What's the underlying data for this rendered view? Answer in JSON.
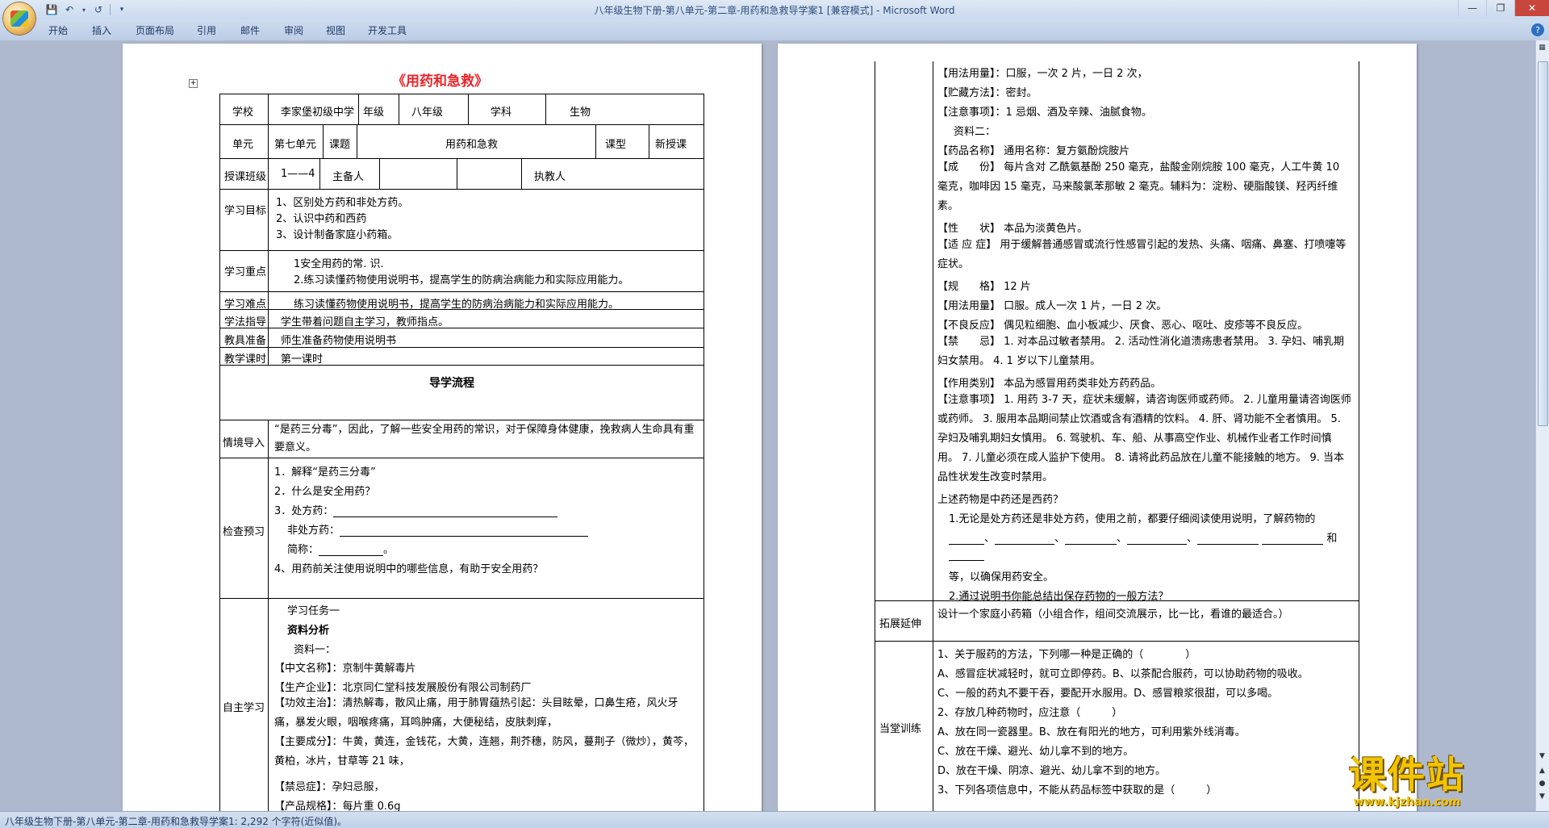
{
  "window": {
    "title": "八年级生物下册-第八单元-第二章-用药和急救导学案1 [兼容模式] - Microsoft Word"
  },
  "ribbon": {
    "tabs": [
      "开始",
      "插入",
      "页面布局",
      "引用",
      "邮件",
      "审阅",
      "视图",
      "开发工具"
    ]
  },
  "statusbar": {
    "text": "八年级生物下册-第八单元-第二章-用药和急救导学案1: 2,292 个字符(近似值)。"
  },
  "watermark": {
    "text": "课件站",
    "url": "www.kjzhan.com",
    "color": "#f2c400"
  },
  "page1": {
    "title": "《用药和急救》",
    "header_rows": {
      "school_label": "学校",
      "school_value": "李家堡初级中学",
      "grade_label": "年级",
      "grade_value": "八年级",
      "subject_label": "学科",
      "subject_value": "生物",
      "unit_label": "单元",
      "unit_value": "第七单元",
      "topic_label": "课题",
      "topic_value": "用药和急救",
      "type_label": "课型",
      "type_value": "新授课",
      "class_label": "授课班级",
      "class_value": "1——4",
      "prep_label": "主备人",
      "teacher_label": "执教人"
    },
    "goals_label": "学习目标",
    "goals": [
      "1、区别处方药和非处方药。",
      "2、认识中药和西药",
      "3、设计制备家庭小药箱。"
    ],
    "focus_label": "学习重点",
    "focus": [
      "1安全用药的常. 识.",
      "2.练习读懂药物使用说明书，提高学生的防病治病能力和实际应用能力。"
    ],
    "difficulty_label": "学习难点",
    "difficulty": "练习读懂药物使用说明书，提高学生的防病治病能力和实际应用能力。",
    "method_label": "学法指导",
    "method": "学生带着问题自主学习，教师指点。",
    "tools_label": "教具准备",
    "tools": "师生准备药物使用说明书",
    "hours_label": "教学课时",
    "hours": "第一课时",
    "flow_title": "导学流程",
    "intro_label": "情境导入",
    "intro": "“是药三分毒”，因此，了解一些安全用药的常识，对于保障身体健康，挽救病人生命具有重要意义。",
    "check_label": "检查预习",
    "check": [
      "1．解释“是药三分毒”",
      "2．什么是安全用药？",
      "3．处方药：",
      "非处方药：",
      "简称：",
      "。",
      "4、用药前关注使用说明中的哪些信息，有助于安全用药？"
    ],
    "self_label": "自主学习",
    "self": [
      "学习任务一",
      "资料分析",
      "资料一：",
      "【中文名称】：京制牛黄解毒片",
      "【生产企业】：北京同仁堂科技发展股份有限公司制药厂",
      "【功效主治】：清热解毒，散风止痛，用于肺胃蕴热引起：头目眩晕，口鼻生疮，风火牙痛，暴发火眼，咽喉疼痛，耳鸣肿痛，大便秘结，皮肤刺痒，",
      "【主要成分】：牛黄，黄连，金钱花，大黄，连翘，荆芥穗，防风，蔓荆子（微炒），黄芩，黄柏，冰片，甘草等 21 味，",
      "【禁忌症】：孕妇忌服，",
      "【产品规格】：每片重 0.6g"
    ]
  },
  "page2": {
    "lines": [
      "【用法用量】：口服，一次 2 片，一日 2 次，",
      "【贮藏方法】：密封。",
      "【注意事项】：1 忌烟、酒及辛辣、油腻食物。",
      "资料二：",
      "【药品名称】 通用名称：复方氨酚烷胺片",
      "【成　　份】 每片含对 乙酰氨基酚 250 毫克，盐酸金刚烷胺 100 毫克，人工牛黄 10 毫克，咖啡因 15 毫克，马来酸氯苯那敏 2 毫克。辅料为：淀粉、硬脂酸镁、羟丙纤维素。",
      "【性　　状】 本品为淡黄色片。",
      "【适 应 症】 用于缓解普通感冒或流行性感冒引起的发热、头痛、咽痛、鼻塞、打喷嚏等症状。",
      "【规　　格】 12 片",
      "【用法用量】 口服。成人一次 1 片，一日 2 次。",
      "【不良反应】 偶见粒细胞、血小板减少、厌食、恶心、呕吐、皮疹等不良反应。",
      "【禁　　忌】 1. 对本品过敏者禁用。 2. 活动性消化道溃疡患者禁用。 3. 孕妇、哺乳期妇女禁用。 4. 1 岁以下儿童禁用。",
      "【作用类别】 本品为感冒用药类非处方药药品。",
      "【注意事项】 1. 用药 3-7 天，症状未缓解，请咨询医师或药师。 2. 儿童用量请咨询医师或药师。 3. 服用本品期间禁止饮酒或含有酒精的饮料。 4. 肝、肾功能不全者慎用。 5. 孕妇及哺乳期妇女慎用。 6. 驾驶机、车、船、从事高空作业、机械作业者工作时间慎用。 7. 儿童必须在成人监护下使用。 8. 请将此药品放在儿童不能接触的地方。 9. 当本品性状发生改变时禁用。",
      "上述药物是中药还是西药？",
      "1.无论是处方药还是非处方药，使用之前，都要仔细阅读使用说明，了解药物的",
      "、",
      "和",
      "等，以确保用药安全。",
      "2.通过说明书你能总结出保存药物的一般方法？"
    ],
    "extend_label": "拓展延伸",
    "extend": "设计一个家庭小药箱（小组合作，组间交流展示，比一比，看谁的最适合。）",
    "practice_label": "当堂训练",
    "practice": [
      "1、关于服药的方法，下列哪一种是正确的（　　　　）",
      "A、感冒症状减轻时，就可立即停药。B、以茶配合服药，可以协助药物的吸收。",
      "C、一般的药丸不要干吞，要配开水服用。D、感冒粮浆很甜，可以多喝。",
      "2、存放几种药物时，应注意（　　　）",
      "A、放在同一瓷器里。B、放在有阳光的地方，可利用紫外线消毒。",
      "C、放在干燥、避光、幼儿拿不到的地方。",
      "D、放在干燥、阴凉、避光、幼儿拿不到的地方。",
      "3、下列各项信息中，不能从药品标签中获取的是（　　　）"
    ]
  }
}
